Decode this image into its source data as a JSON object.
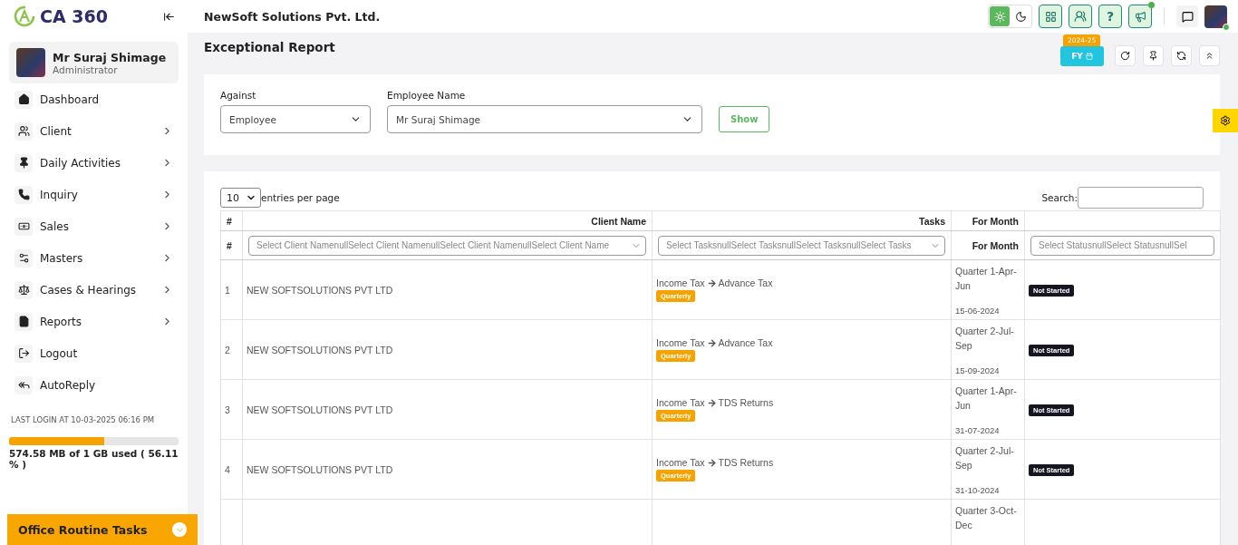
{
  "sidebar": {
    "logo": "CA 360",
    "profile": {
      "name": "Mr Suraj Shimage",
      "role": "Administrator"
    },
    "items": [
      {
        "label": "Dashboard",
        "has_children": false
      },
      {
        "label": "Client",
        "has_children": true
      },
      {
        "label": "Daily Activities",
        "has_children": true
      },
      {
        "label": "Inquiry",
        "has_children": true
      },
      {
        "label": "Sales",
        "has_children": true
      },
      {
        "label": "Masters",
        "has_children": true
      },
      {
        "label": "Cases & Hearings",
        "has_children": true
      },
      {
        "label": "Reports",
        "has_children": true
      },
      {
        "label": "Logout",
        "has_children": false
      },
      {
        "label": "AutoReply",
        "has_children": false
      }
    ],
    "last_login": "LAST LOGIN AT 10-03-2025 06:16 PM",
    "storage": {
      "level": 0.5611,
      "reading": "574.58 MB of 1 GB used ( 56.11 % )"
    },
    "footer": "Office Routine Tasks"
  },
  "topbar": {
    "company": "NewSoft Solutions Pvt. Ltd.",
    "theme_options": [
      {
        "kind": "light",
        "selected": true
      },
      {
        "kind": "dark",
        "selected": false
      }
    ],
    "help": "?",
    "notification_dot": true
  },
  "page": {
    "title": "Exceptional Report",
    "fy_year": "2024-25",
    "fy_label": "FY"
  },
  "filters": [
    {
      "label": "Against",
      "value": "Employee"
    },
    {
      "label": "Employee Name",
      "value": "Mr Suraj Shimage"
    }
  ],
  "show_button": "Show",
  "table": {
    "page_size": "10",
    "page_size_label": "entries per page",
    "search_label": "Search:",
    "columns": [
      "#",
      "Client Name",
      "Tasks",
      "For Month"
    ],
    "filter_row": [
      "#",
      "Select Client NamenullSelect Client NamenullSelect Client NamenullSelect Client Name",
      "Select TasksnullSelect TasksnullSelect TasksnullSelect Tasks",
      "For Month",
      "Select StatusnullSelect StatusnullSel"
    ],
    "rows": [
      {
        "index": "1",
        "client": "NEW SOFTSOLUTIONS PVT LTD",
        "task_group": "Income Tax",
        "task": "Advance Tax",
        "frequency": "Quarterly",
        "period": "Quarter 1-Apr-Jun",
        "date": "15-06-2024",
        "status": "Not Started"
      },
      {
        "index": "2",
        "client": "NEW SOFTSOLUTIONS PVT LTD",
        "task_group": "Income Tax",
        "task": "Advance Tax",
        "frequency": "Quarterly",
        "period": "Quarter 2-Jul-Sep",
        "date": "15-09-2024",
        "status": "Not Started"
      },
      {
        "index": "3",
        "client": "NEW SOFTSOLUTIONS PVT LTD",
        "task_group": "Income Tax",
        "task": "TDS Returns",
        "frequency": "Quarterly",
        "period": "Quarter 1-Apr-Jun",
        "date": "31-07-2024",
        "status": "Not Started"
      },
      {
        "index": "4",
        "client": "NEW SOFTSOLUTIONS PVT LTD",
        "task_group": "Income Tax",
        "task": "TDS Returns",
        "frequency": "Quarterly",
        "period": "Quarter 2-Jul-Sep",
        "date": "31-10-2024",
        "status": "Not Started"
      },
      {
        "period": "Quarter 3-Oct-Dec"
      }
    ]
  }
}
